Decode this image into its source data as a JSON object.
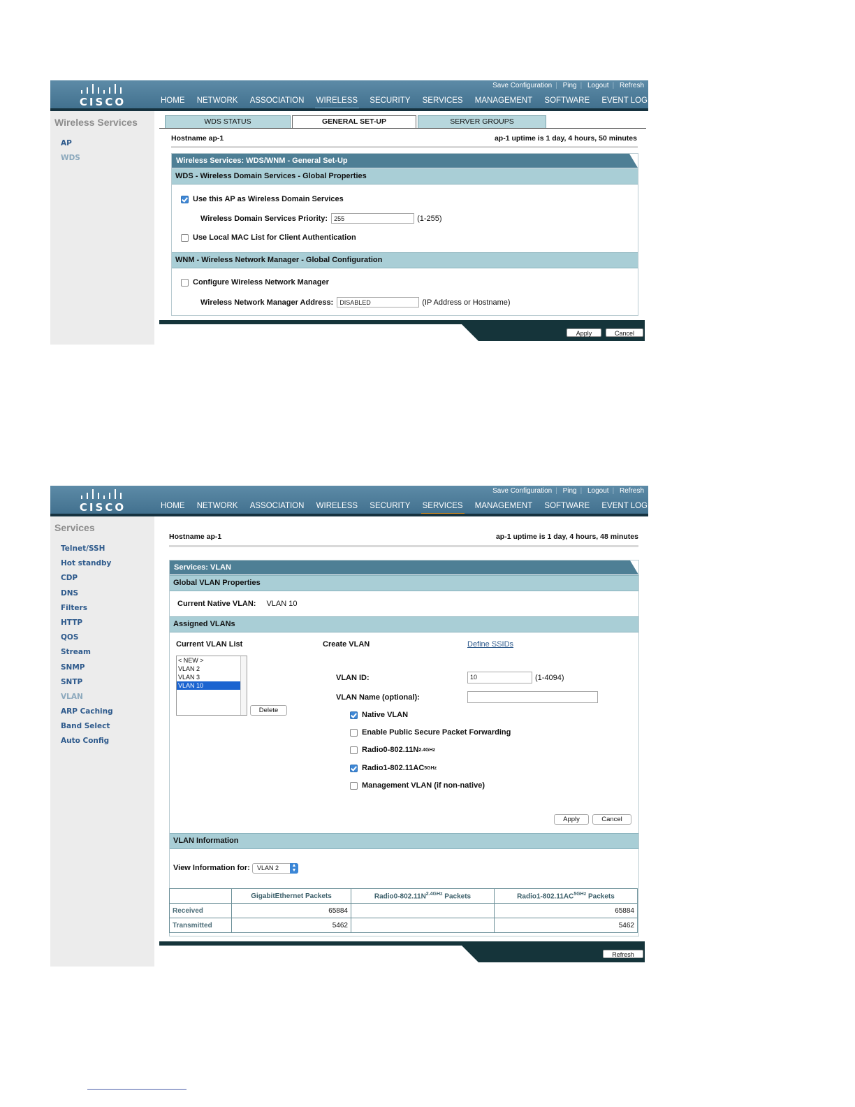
{
  "header": {
    "logo_text": "CISCO",
    "utility_links": [
      "Save Configuration",
      "Ping",
      "Logout",
      "Refresh"
    ],
    "nav": [
      "HOME",
      "NETWORK",
      "ASSOCIATION",
      "WIRELESS",
      "SECURITY",
      "SERVICES",
      "MANAGEMENT",
      "SOFTWARE",
      "EVENT LOG"
    ]
  },
  "screen1": {
    "sidebar": {
      "title": "Wireless Services",
      "items": [
        "AP",
        "WDS"
      ]
    },
    "tabs": [
      "WDS STATUS",
      "GENERAL SET-UP",
      "SERVER GROUPS"
    ],
    "hostname_label": "Hostname  ap-1",
    "uptime": "ap-1 uptime is 1 day, 4 hours, 50 minutes",
    "panel_title": "Wireless Services: WDS/WNM - General Set-Up",
    "wds_section": "WDS - Wireless Domain Services - Global Properties",
    "use_wds_label": "Use this AP as Wireless Domain Services",
    "use_wds_checked": true,
    "priority_label": "Wireless Domain Services Priority:",
    "priority_value": "255",
    "priority_hint": "(1-255)",
    "local_mac_label": "Use Local MAC List for Client Authentication",
    "local_mac_checked": false,
    "wnm_section": "WNM - Wireless Network Manager - Global Configuration",
    "configure_wnm_label": "Configure Wireless Network Manager",
    "configure_wnm_checked": false,
    "wnm_address_label": "Wireless Network Manager Address:",
    "wnm_address_value": "DISABLED",
    "wnm_address_hint": "(IP Address or Hostname)",
    "apply": "Apply",
    "cancel": "Cancel"
  },
  "screen2": {
    "sidebar": {
      "title": "Services",
      "items": [
        "Telnet/SSH",
        "Hot standby",
        "CDP",
        "DNS",
        "Filters",
        "HTTP",
        "QOS",
        "Stream",
        "SNMP",
        "SNTP",
        "VLAN",
        "ARP Caching",
        "Band Select",
        "Auto Config"
      ]
    },
    "hostname_label": "Hostname  ap-1",
    "uptime": "ap-1 uptime is 1 day, 4 hours, 48 minutes",
    "panel_title": "Services: VLAN",
    "global_section": "Global VLAN Properties",
    "native_vlan_label": "Current Native VLAN:",
    "native_vlan_value": "VLAN 10",
    "assigned_section": "Assigned VLANs",
    "current_list_label": "Current VLAN List",
    "vlan_list": [
      "< NEW >",
      "VLAN 2",
      "VLAN 3",
      "VLAN 10"
    ],
    "vlan_list_selected": "VLAN 10",
    "delete": "Delete",
    "create_vlan_label": "Create VLAN",
    "define_ssids": "Define SSIDs",
    "vlan_id_label": "VLAN ID:",
    "vlan_id_value": "10",
    "vlan_id_hint": "(1-4094)",
    "vlan_name_label": "VLAN Name (optional):",
    "vlan_name_value": "",
    "native_vlan_cb": "Native VLAN",
    "native_vlan_checked": true,
    "public_secure_cb": "Enable Public Secure Packet Forwarding",
    "public_secure_checked": false,
    "radio0_cb": "Radio0-802.11N",
    "radio0_sup": "2.4GHz",
    "radio0_checked": false,
    "radio1_cb": "Radio1-802.11AC",
    "radio1_sup": "5GHz",
    "radio1_checked": true,
    "mgmt_cb": "Management VLAN (if non-native)",
    "mgmt_checked": false,
    "apply": "Apply",
    "cancel": "Cancel",
    "info_section": "VLAN Information",
    "view_info_label": "View Information for:",
    "view_info_value": "VLAN 2",
    "table_headers": {
      "gig": "GigabitEthernet Packets",
      "r0": "Radio0-802.11N",
      "r0_sup": "2.4GHz",
      "r0_tail": " Packets",
      "r1": "Radio1-802.11AC",
      "r1_sup": "5GHz",
      "r1_tail": " Packets"
    },
    "rows": [
      {
        "label": "Received",
        "gig": "65884",
        "r0": "",
        "r1": "65884"
      },
      {
        "label": "Transmitted",
        "gig": "5462",
        "r0": "",
        "r1": "5462"
      }
    ],
    "refresh": "Refresh"
  },
  "colors": {
    "header": "#4a7a98",
    "section_bar": "#a9ced6",
    "panel_head": "#4e7f95",
    "footer": "#15343a",
    "nav_active": "#e8951d",
    "link": "#2e5a8c"
  }
}
